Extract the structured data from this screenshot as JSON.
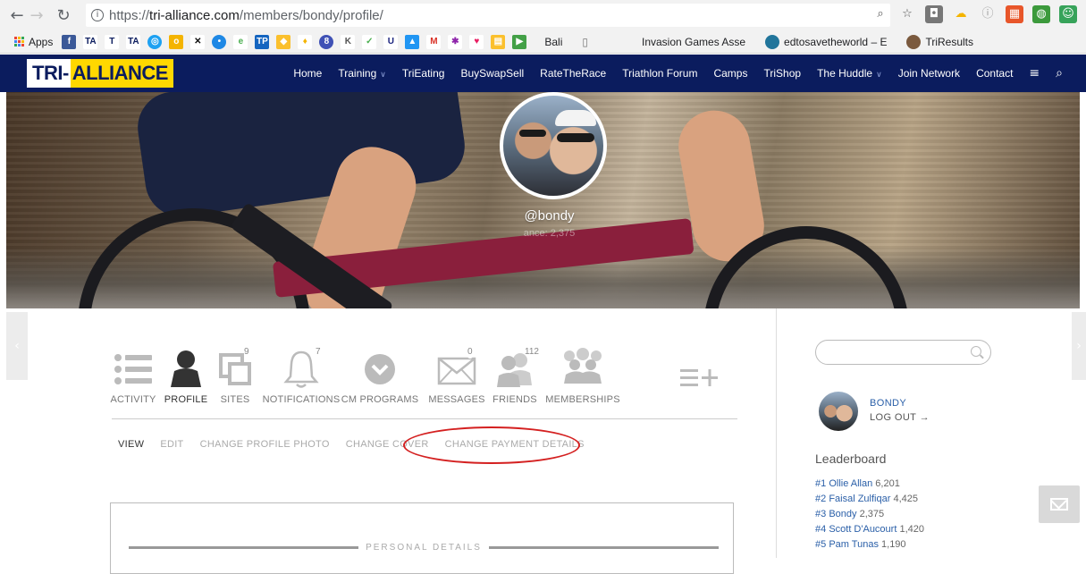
{
  "browser": {
    "url_prefix": "https://",
    "url_host": "tri-alliance.com",
    "url_path": "/members/bondy/profile/",
    "bookmarks": {
      "apps_label": "Apps",
      "items": [
        "Bali",
        "Invasion Games Asse",
        "edtosavetheworld – E",
        "TriResults"
      ]
    }
  },
  "site": {
    "logo_part1": "TRI-",
    "logo_part2": "ALLIANCE",
    "nav": [
      "Home",
      "Training",
      "TriEating",
      "BuySwapSell",
      "RateTheRace",
      "Triathlon Forum",
      "Camps",
      "TriShop",
      "The Huddle",
      "Join Network",
      "Contact"
    ]
  },
  "profile": {
    "handle": "@bondy",
    "subtext": "ance: 2,375"
  },
  "tabs": [
    {
      "label": "ACTIVITY",
      "icon": "list-icon"
    },
    {
      "label": "PROFILE",
      "icon": "person-icon"
    },
    {
      "label": "SITES",
      "icon": "sites-icon",
      "badge": "9"
    },
    {
      "label": "NOTIFICATIONS",
      "icon": "bell-icon",
      "badge": "7"
    },
    {
      "label": "CM PROGRAMS",
      "icon": "chevron-circle-icon"
    },
    {
      "label": "MESSAGES",
      "icon": "envelope-icon",
      "badge": "0"
    },
    {
      "label": "FRIENDS",
      "icon": "friends-icon",
      "badge": "112"
    },
    {
      "label": "MEMBERSHIPS",
      "icon": "group-icon"
    }
  ],
  "subtabs": [
    "VIEW",
    "EDIT",
    "CHANGE PROFILE PHOTO",
    "CHANGE COVER",
    "CHANGE PAYMENT DETAILS"
  ],
  "panel": {
    "title": "PERSONAL DETAILS"
  },
  "sidebar": {
    "user_name": "BONDY",
    "logout": "LOG OUT →",
    "leaderboard_title": "Leaderboard",
    "leaderboard": [
      {
        "rank": "#1",
        "name": "Ollie Allan",
        "points": "6,201"
      },
      {
        "rank": "#2",
        "name": "Faisal Zulfiqar",
        "points": "4,425"
      },
      {
        "rank": "#3",
        "name": "Bondy",
        "points": "2,375"
      },
      {
        "rank": "#4",
        "name": "Scott D'Aucourt",
        "points": "1,420"
      },
      {
        "rank": "#5",
        "name": "Pam Tunas",
        "points": "1,190"
      }
    ]
  },
  "colors": {
    "nav_bg": "#0b1c5e",
    "logo_yellow": "#ffd800",
    "link_blue": "#2a5fa8",
    "highlight_red": "#d42020"
  }
}
